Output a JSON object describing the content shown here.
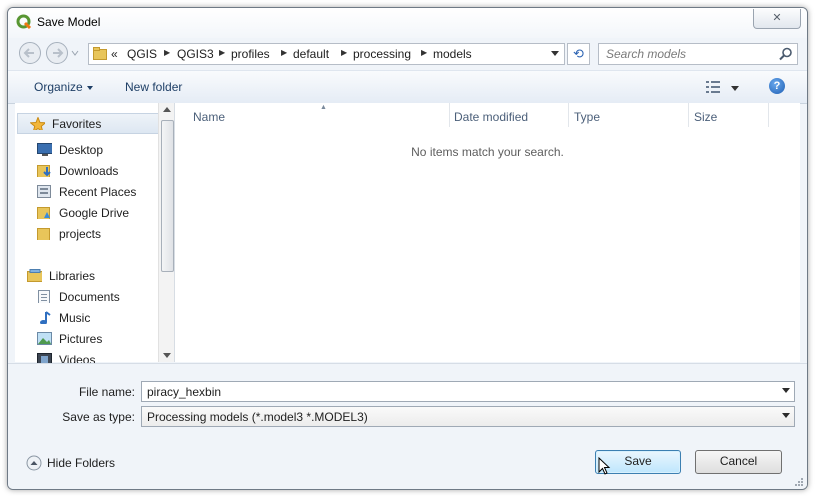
{
  "window": {
    "title": "Save Model",
    "close_symbol": "✕"
  },
  "address": {
    "overflow": "«",
    "crumbs": [
      "QGIS",
      "QGIS3",
      "profiles",
      "default",
      "processing",
      "models"
    ],
    "refresh_symbol": "⟲"
  },
  "search": {
    "placeholder": "Search models"
  },
  "toolbar": {
    "organize_label": "Organize",
    "new_folder_label": "New folder",
    "help_symbol": "?"
  },
  "nav": {
    "favorites_label": "Favorites",
    "favorites": [
      "Desktop",
      "Downloads",
      "Recent Places",
      "Google Drive",
      "projects"
    ],
    "libraries_label": "Libraries",
    "libraries": [
      "Documents",
      "Music",
      "Pictures",
      "Videos"
    ]
  },
  "content": {
    "columns": [
      "Name",
      "Date modified",
      "Type",
      "Size"
    ],
    "empty_message": "No items match your search."
  },
  "form": {
    "file_name_label": "File name:",
    "file_name_value": "piracy_hexbin",
    "save_type_label": "Save as type:",
    "save_type_value": "Processing models (*.model3 *.MODEL3)"
  },
  "footer": {
    "hide_folders_label": "Hide Folders",
    "save_label": "Save",
    "cancel_label": "Cancel"
  },
  "colors": {
    "accent": "#3c7fb1",
    "title_blue": "#1e3f66",
    "qgis_green": "#589632"
  }
}
